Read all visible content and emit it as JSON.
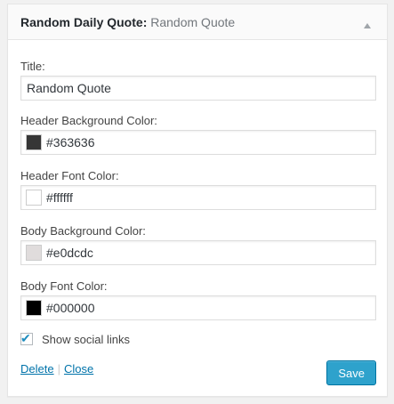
{
  "widget": {
    "title": "Random Daily Quote",
    "title_separator": ":",
    "title_suffix": "Random Quote",
    "toggle_icon": "arrow-up-icon"
  },
  "fields": {
    "title": {
      "label": "Title:",
      "value": "Random Quote"
    },
    "header_bg": {
      "label": "Header Background Color:",
      "value": "#363636",
      "swatch": "#363636"
    },
    "header_font": {
      "label": "Header Font Color:",
      "value": "#ffffff",
      "swatch": "#ffffff"
    },
    "body_bg": {
      "label": "Body Background Color:",
      "value": "#e0dcdc",
      "swatch": "#e0dcdc"
    },
    "body_font": {
      "label": "Body Font Color:",
      "value": "#000000",
      "swatch": "#000000"
    }
  },
  "social": {
    "label": "Show social links",
    "checked": true
  },
  "actions": {
    "delete": "Delete",
    "separator": "|",
    "close": "Close",
    "save": "Save"
  },
  "colors": {
    "accent": "#0073aa",
    "button": "#2ea2cc"
  }
}
